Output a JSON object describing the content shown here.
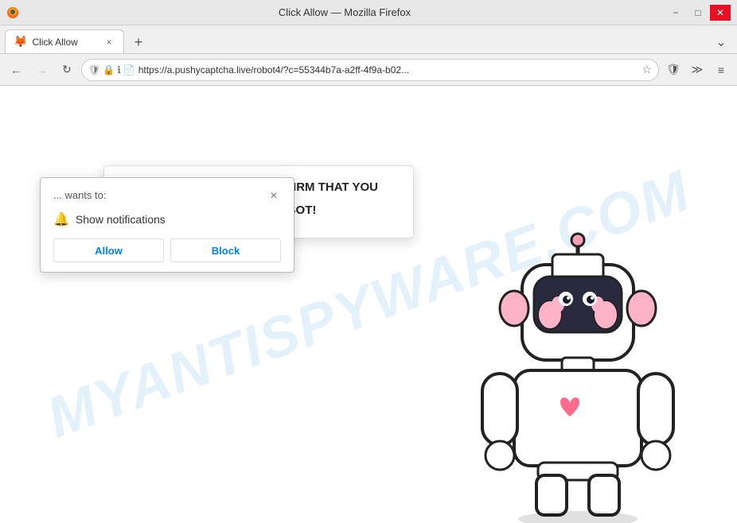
{
  "titlebar": {
    "title": "Click Allow — Mozilla Firefox",
    "minimize_label": "−",
    "maximize_label": "□",
    "close_label": "✕"
  },
  "tab": {
    "label": "Click Allow",
    "favicon": "🦊"
  },
  "toolbar": {
    "back_label": "←",
    "forward_label": "→",
    "reload_label": "↻",
    "url": "https://a.pushycaptcha.live/robot4/?c=55344b7a-a2ff-4f9a-b02...",
    "bookmark_label": "☆",
    "shield_label": "🛡",
    "extensions_label": "≫",
    "menu_label": "≡",
    "new_tab_label": "+"
  },
  "notification_popup": {
    "wants_text": "... wants to:",
    "show_notifications_text": "Show notifications",
    "allow_label": "Allow",
    "block_label": "Block",
    "close_label": "×"
  },
  "speech_bubble": {
    "line1": "CLICK «ALLOW» TO CONFIRM THAT YOU",
    "line2": "ARE NOT A ROBOT!"
  },
  "watermark": {
    "text": "MYANTISPYWARE.COM"
  }
}
